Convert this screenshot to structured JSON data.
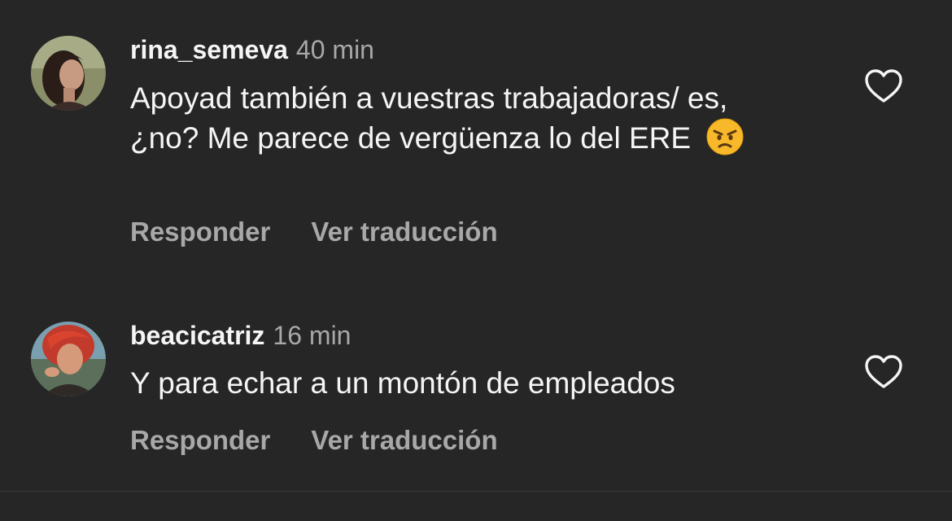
{
  "comments": [
    {
      "username": "rina_semeva",
      "time": "40 min",
      "text": "Apoyad también a vuestras trabajadoras/ es, ¿no? Me parece de vergüenza lo del ERE",
      "emoji": "angry-face-emoji",
      "reply_label": "Responder",
      "translate_label": "Ver traducción",
      "like_icon": "heart-outline-icon"
    },
    {
      "username": "beacicatriz",
      "time": "16 min",
      "text": "Y para echar a un montón de empleados",
      "reply_label": "Responder",
      "translate_label": "Ver traducción",
      "like_icon": "heart-outline-icon"
    }
  ],
  "colors": {
    "background": "#262626",
    "primary_text": "#f5f5f5",
    "secondary_text": "#a8a8a8"
  }
}
